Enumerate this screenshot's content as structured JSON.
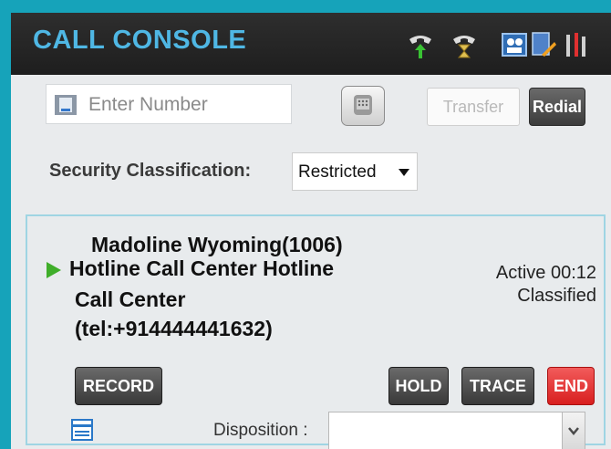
{
  "header": {
    "title": "CALL CONSOLE",
    "icons": [
      "phone-up-icon",
      "phone-wait-icon",
      "agent-status-icon",
      "edit-notes-icon",
      "tools-icon"
    ]
  },
  "dialer": {
    "number_placeholder": "Enter Number",
    "number_value": "",
    "transfer_label": "Transfer",
    "redial_label": "Redial"
  },
  "security": {
    "label": "Security Classification:",
    "selected": "Restricted"
  },
  "call": {
    "line1": "Madoline Wyoming(1006)",
    "line2": "Hotline Call Center Hotline",
    "line3": "Call Center",
    "line4": "(tel:+914444441632)",
    "status": "Active 00:12",
    "classification": "Classified",
    "record_label": "RECORD",
    "hold_label": "HOLD",
    "trace_label": "TRACE",
    "end_label": "END",
    "disposition_label": "Disposition :",
    "disposition_value": ""
  },
  "colors": {
    "frame": "#16a3ba",
    "header_bg": "#262626",
    "title": "#4fb7e4",
    "end_button": "#e02b2b",
    "play_icon": "#3fae2a"
  }
}
